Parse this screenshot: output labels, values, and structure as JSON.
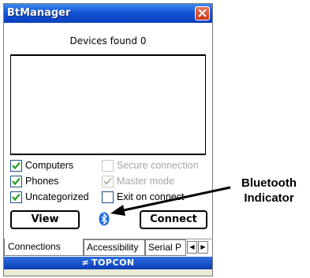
{
  "window": {
    "title": "BtManager"
  },
  "devices_found": "Devices found 0",
  "options": [
    {
      "label": "Computers",
      "checked": true,
      "enabled": true
    },
    {
      "label": "Secure connection",
      "checked": false,
      "enabled": false
    },
    {
      "label": "Phones",
      "checked": true,
      "enabled": true
    },
    {
      "label": "Master mode",
      "checked": true,
      "enabled": false
    },
    {
      "label": "Uncategorized",
      "checked": true,
      "enabled": true
    },
    {
      "label": "Exit on connect",
      "checked": false,
      "enabled": true
    }
  ],
  "buttons": {
    "view": "View",
    "connect": "Connect"
  },
  "tabs": [
    "Connections",
    "Accessibility",
    "Serial P"
  ],
  "brand": "TOPCON",
  "annotation": {
    "line1": "Bluetooth",
    "line2": "Indicator"
  },
  "colors": {
    "titlebar": "#1455d6",
    "bluetooth": "#1d6fe0",
    "brand_bar": "#0a3cb4"
  }
}
